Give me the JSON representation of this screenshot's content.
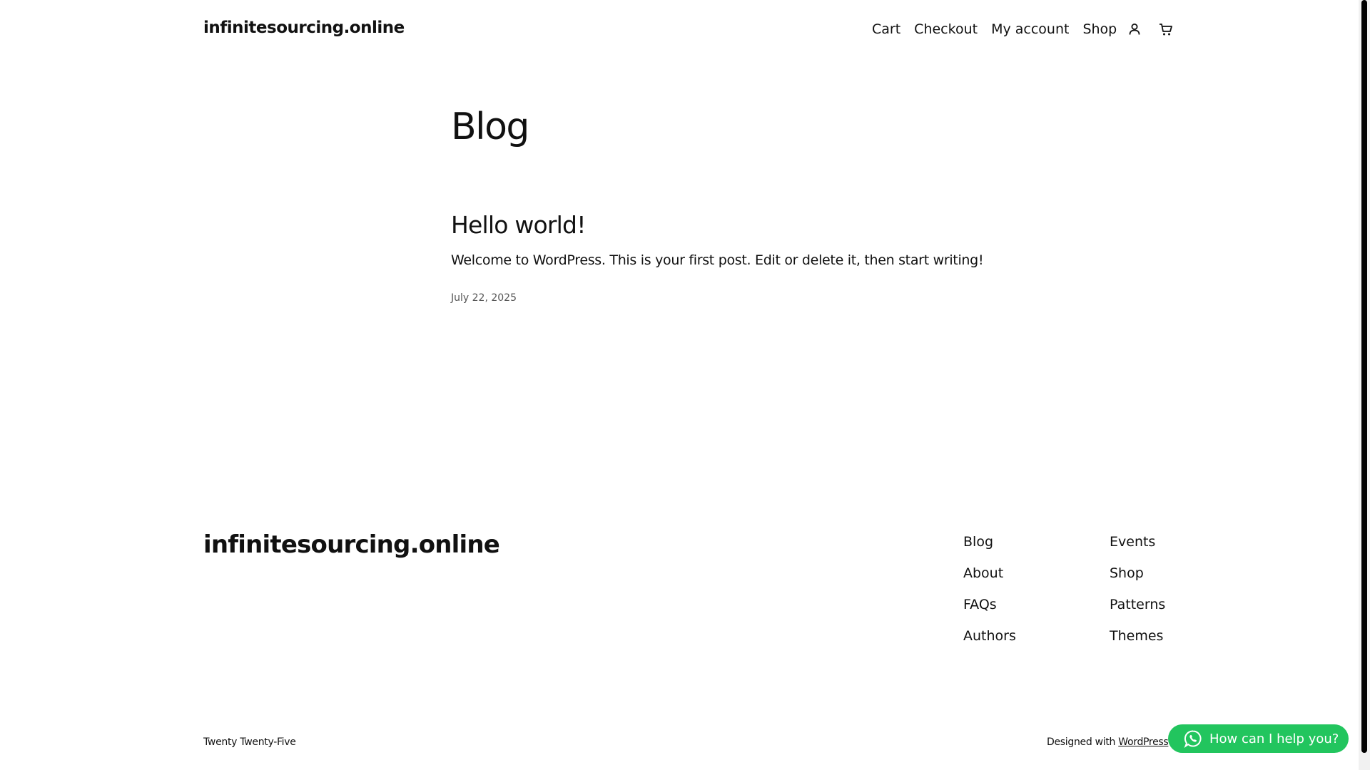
{
  "header": {
    "site_title": "infinitesourcing.online",
    "nav": [
      "Cart",
      "Checkout",
      "My account",
      "Shop"
    ],
    "account_icon": "user-icon",
    "cart_icon": "cart-icon"
  },
  "main": {
    "page_title": "Blog",
    "post": {
      "title": "Hello world!",
      "excerpt": "Welcome to WordPress. This is your first post. Edit or delete it, then start writing!",
      "date": "July 22, 2025"
    }
  },
  "footer": {
    "site_title": "infinitesourcing.online",
    "col1": [
      "Blog",
      "About",
      "FAQs",
      "Authors"
    ],
    "col2": [
      "Events",
      "Shop",
      "Patterns",
      "Themes"
    ],
    "theme_credit": "Twenty Twenty-Five",
    "designed_with": "Designed with",
    "wordpress_link": "WordPress"
  },
  "chat": {
    "label": "How can I help you?",
    "icon": "whatsapp-icon",
    "color": "#22c55e"
  }
}
